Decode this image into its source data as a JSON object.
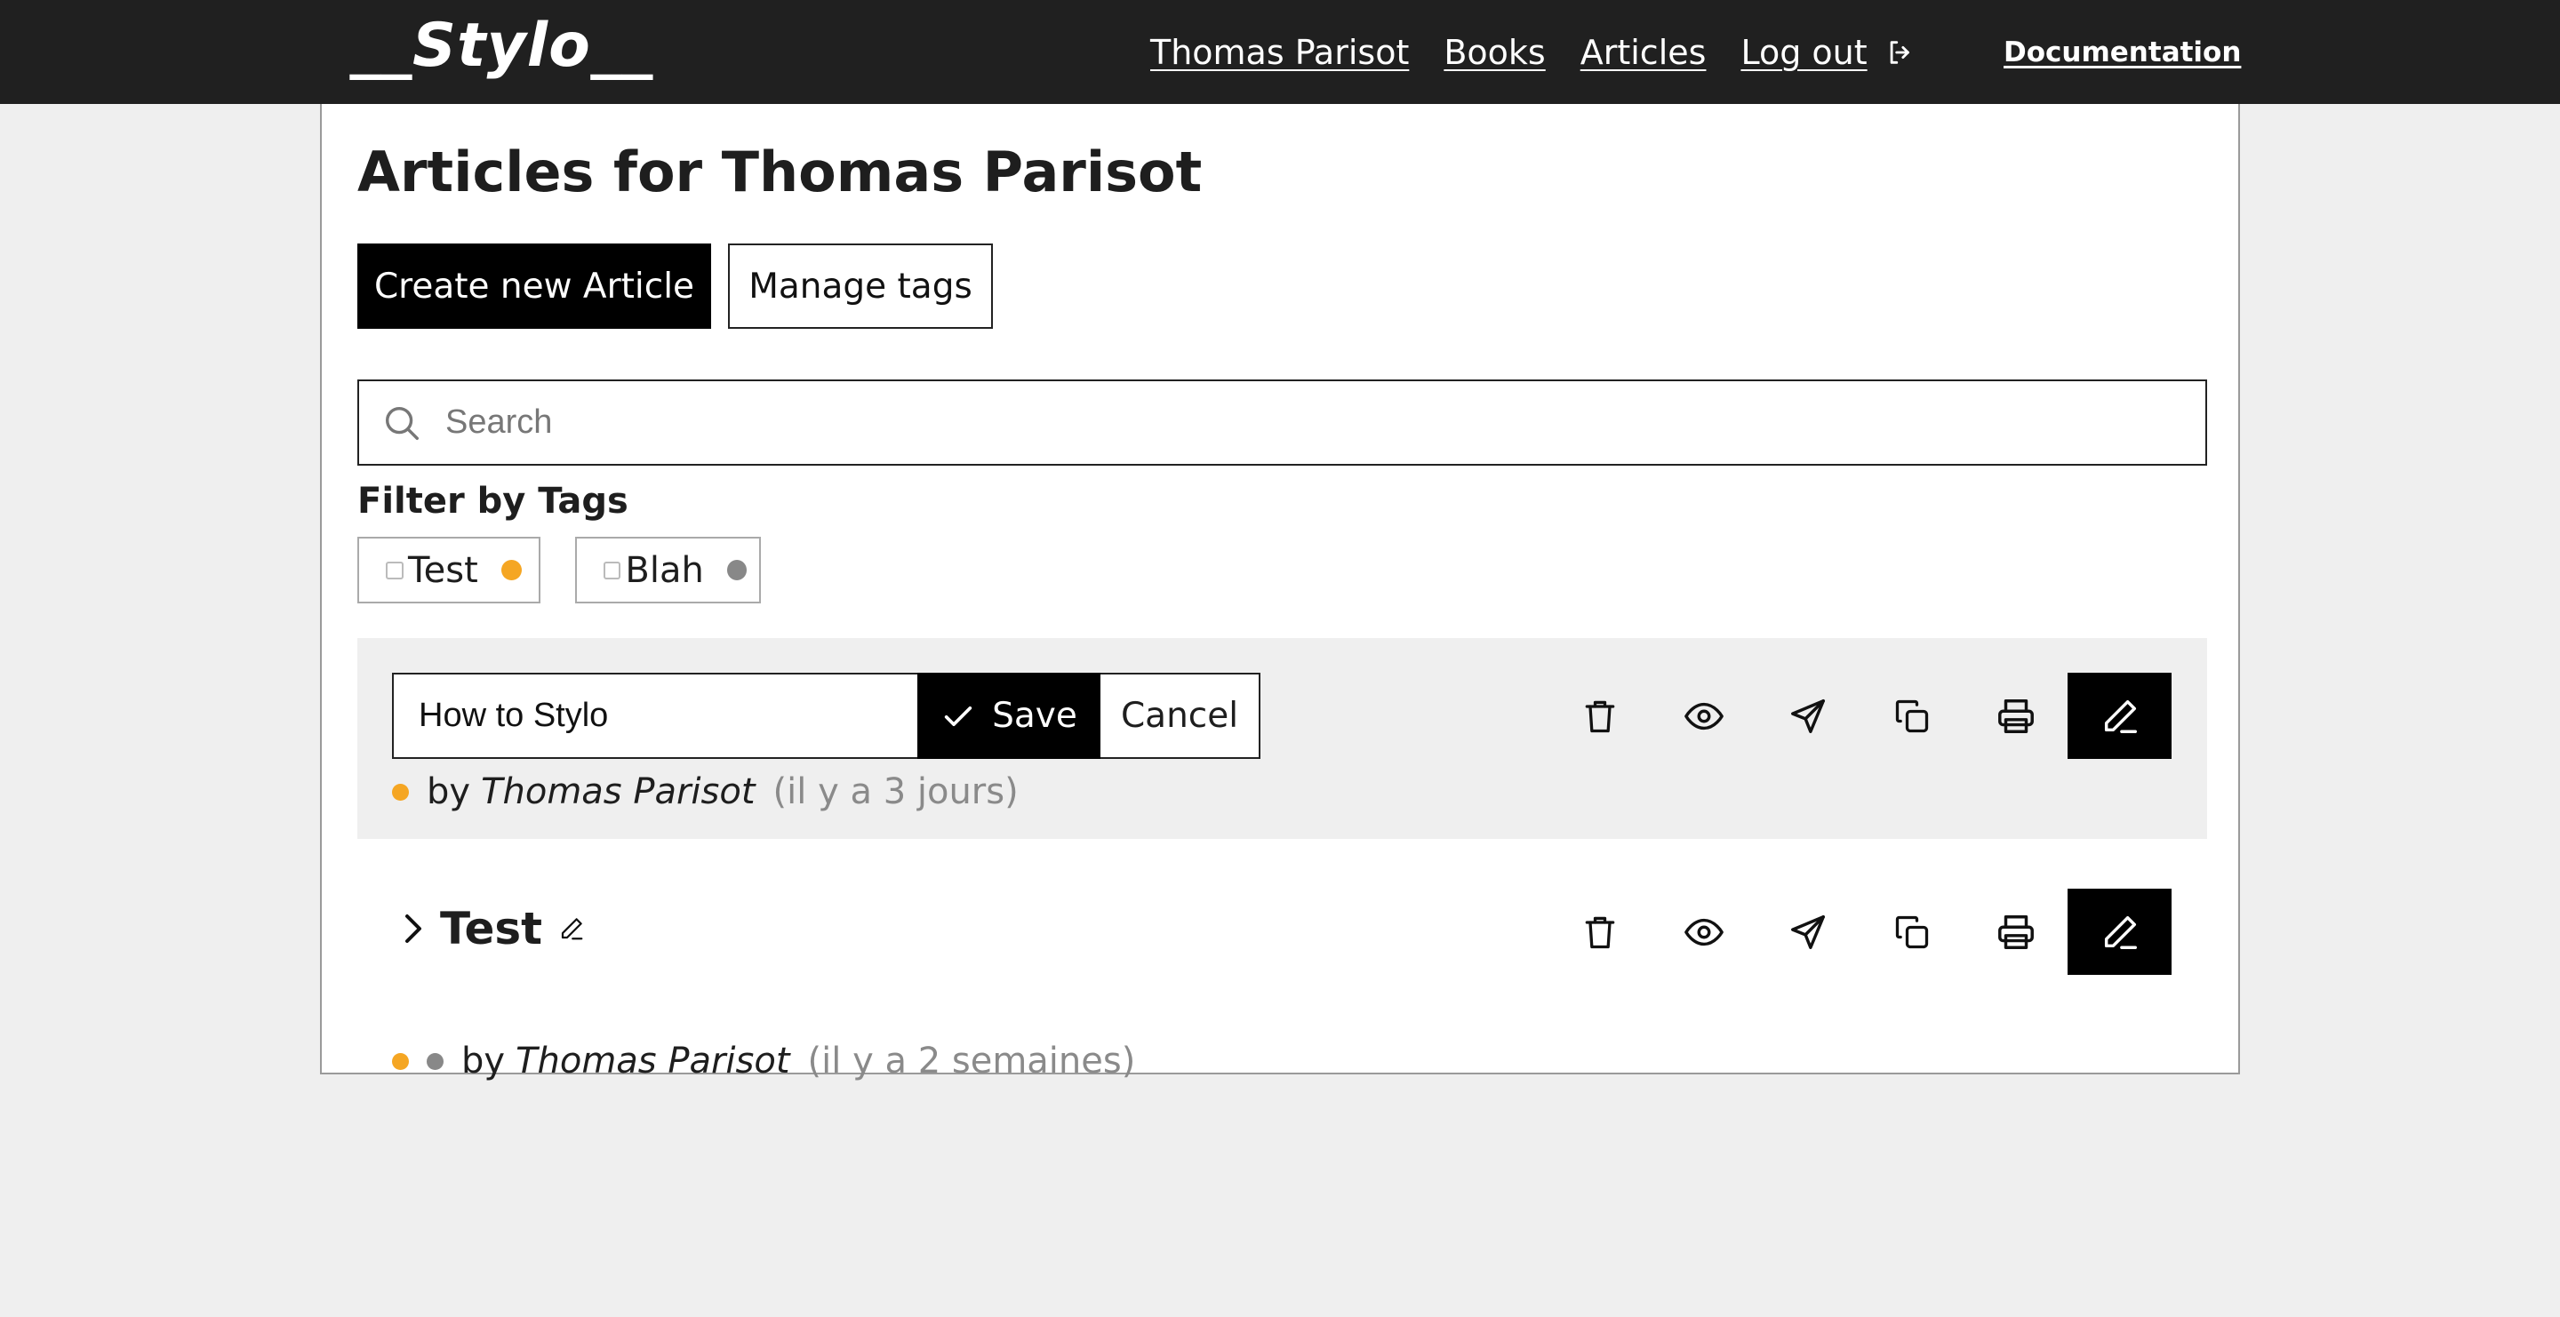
{
  "header": {
    "logo": "__Stylo__",
    "nav": [
      "Thomas Parisot",
      "Books",
      "Articles",
      "Log out"
    ],
    "documentation": "Documentation"
  },
  "page": {
    "title": "Articles for Thomas Parisot",
    "create_button": "Create new Article",
    "manage_tags_button": "Manage tags",
    "search_placeholder": "Search",
    "filter_label": "Filter by Tags",
    "tags": [
      {
        "label": "Test",
        "color": "#f5a623"
      },
      {
        "label": "Blah",
        "color": "#888888"
      }
    ]
  },
  "articles": [
    {
      "edit_value": "How to Stylo",
      "save_label": "Save",
      "cancel_label": "Cancel",
      "by": "by",
      "author": "Thomas Parisot",
      "time": "(il y a 3 jours)",
      "tag_colors": [
        "#f5a623"
      ]
    },
    {
      "title": "Test",
      "by": "by",
      "author": "Thomas Parisot",
      "time": "(il y a 2 semaines)",
      "tag_colors": [
        "#f5a623",
        "#888888"
      ]
    }
  ],
  "action_icons": [
    "trash-icon",
    "eye-icon",
    "send-icon",
    "copy-icon",
    "printer-icon",
    "pencil-icon"
  ]
}
